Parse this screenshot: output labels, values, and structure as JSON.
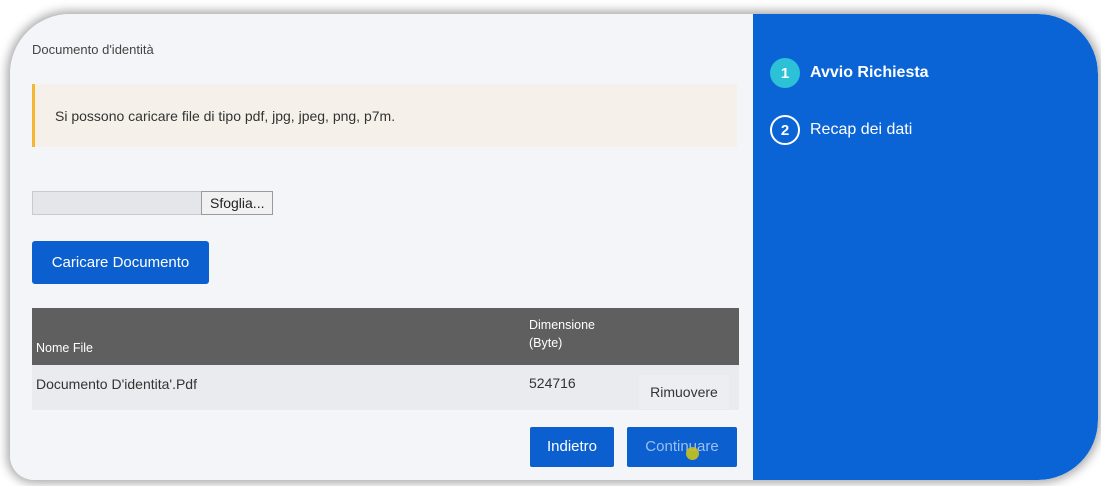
{
  "section_label": "Documento d'identità",
  "alert": {
    "text": "Si possono caricare file di tipo pdf, jpg, jpeg, png, p7m.",
    "accent_color": "#f4b731"
  },
  "file_picker": {
    "value": "",
    "browse_label": "Sfoglia..."
  },
  "upload_button_label": "Caricare Documento",
  "table": {
    "headers": {
      "name": "Nome File",
      "size_line1": "Dimensione",
      "size_line2": "(Byte)"
    },
    "rows": [
      {
        "name": "Documento D'identita'.Pdf",
        "size": "524716",
        "action": "Rimuovere"
      }
    ]
  },
  "footer": {
    "back_label": "Indietro",
    "continue_label": "Continuare"
  },
  "steps": [
    {
      "number": "1",
      "label": "Avvio Richiesta",
      "state": "active"
    },
    {
      "number": "2",
      "label": "Recap dei dati",
      "state": "inactive"
    }
  ],
  "colors": {
    "primary": "#0b5fcf",
    "sidebar": "#0a64d6",
    "step_active": "#2cc1d6",
    "table_header": "#5f5f5f"
  }
}
